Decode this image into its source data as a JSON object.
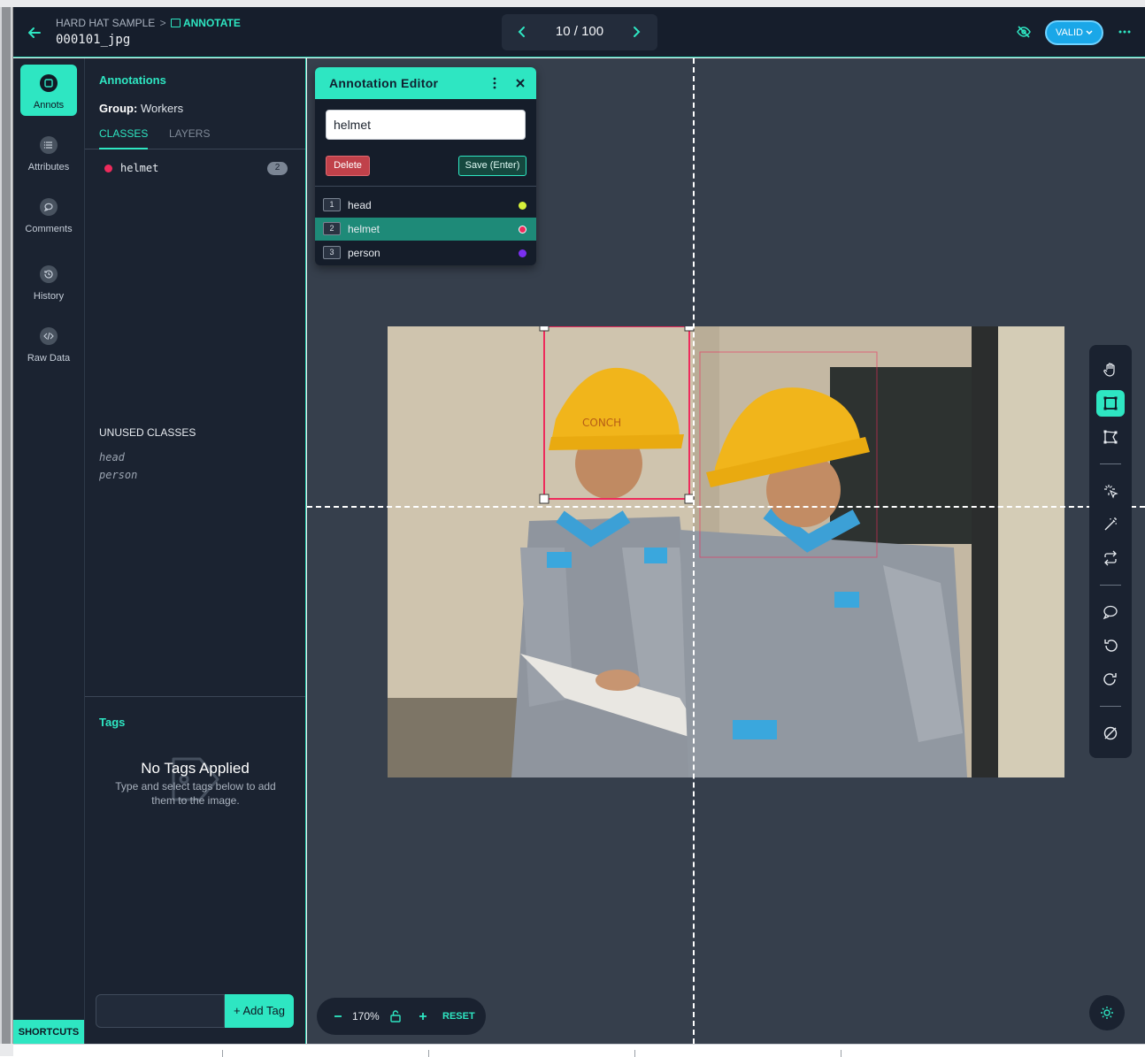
{
  "header": {
    "project": "HARD HAT SAMPLE",
    "mode": "ANNOTATE",
    "filename": "000101_jpg",
    "pager": "10 / 100",
    "status": "VALID"
  },
  "rail": {
    "items": [
      {
        "label": "Annots",
        "icon": "annotation-icon",
        "active": true
      },
      {
        "label": "Attributes",
        "icon": "list-icon"
      },
      {
        "label": "Comments",
        "icon": "comment-icon"
      },
      {
        "label": "History",
        "icon": "history-icon"
      },
      {
        "label": "Raw Data",
        "icon": "code-icon"
      }
    ],
    "shortcuts": "SHORTCUTS"
  },
  "panel": {
    "title": "Annotations",
    "group_label": "Group:",
    "group_value": "Workers",
    "tabs": [
      "CLASSES",
      "LAYERS"
    ],
    "classes": [
      {
        "name": "helmet",
        "count": "2",
        "color": "#ee2b5c"
      }
    ],
    "unused_title": "UNUSED CLASSES",
    "unused": [
      "head",
      "person"
    ],
    "tags": {
      "title": "Tags",
      "empty_title": "No Tags Applied",
      "empty_sub": "Type and select tags below to add them to the image.",
      "add_label": "+ Add Tag"
    }
  },
  "editor": {
    "title": "Annotation Editor",
    "value": "helmet",
    "delete": "Delete",
    "save": "Save (Enter)",
    "options": [
      {
        "num": "1",
        "name": "head",
        "color": "#d6f03a"
      },
      {
        "num": "2",
        "name": "helmet",
        "color": "#ee2b5c",
        "selected": true
      },
      {
        "num": "3",
        "name": "person",
        "color": "#7a2ff0"
      }
    ]
  },
  "zoom": {
    "level": "170%",
    "reset": "RESET"
  },
  "colors": {
    "accent": "#2ee6c2",
    "helmet": "#ee2b5c",
    "valid": "#1aa7e8"
  }
}
